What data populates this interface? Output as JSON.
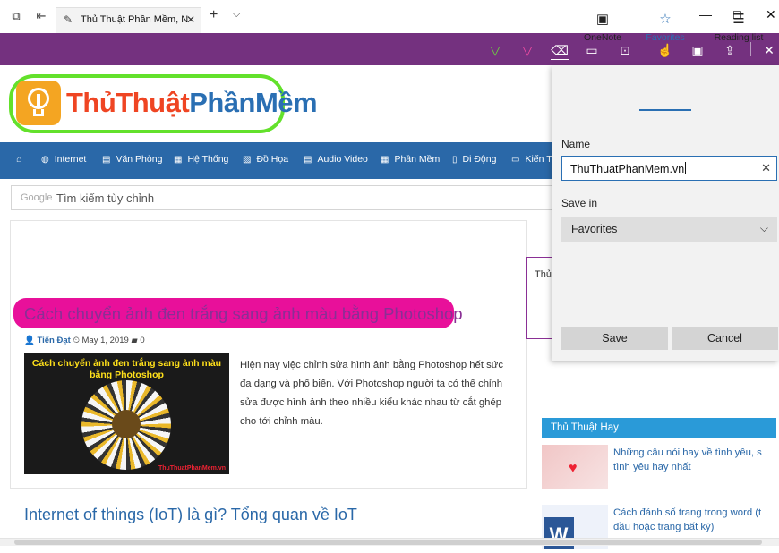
{
  "browser": {
    "tab_title": "Thủ Thuật Phần Mềm, N",
    "new_tab": "+",
    "close_glyph": "✕"
  },
  "site": {
    "logo_part1": "ThủThuật",
    "logo_part2": "PhầnMềm",
    "nav": [
      "Internet",
      "Văn Phòng",
      "Hệ Thống",
      "Đồ Họa",
      "Audio Video",
      "Phần Mềm",
      "Di Động",
      "Kiến T"
    ],
    "search_brand": "Google",
    "search_placeholder": "Tìm kiếm tùy chỉnh"
  },
  "article": {
    "title": "Cách chuyển ảnh đen trắng sang ảnh màu bằng Photoshop",
    "author": "Tiến Đạt",
    "date": "May 1, 2019",
    "comments": "0",
    "thumb_caption": "Cách chuyển ảnh đen trắng sang ảnh màu bằng Photoshop",
    "thumb_watermark": "ThuThuatPhanMem.vn",
    "excerpt": "Hiện nay việc chỉnh sửa hình ảnh bằng Photoshop hết sức đa dạng và phổ biến. Với Photoshop người ta có thể chỉnh sửa được hình ảnh theo nhiều kiểu khác nhau từ cắt ghép cho tới chỉnh màu."
  },
  "article2": {
    "title": "Internet of things (IoT) là gì? Tổng quan về IoT"
  },
  "sidebar": {
    "stub_text": "Thủ",
    "header": "Thủ Thuật Hay",
    "items": [
      {
        "title": "Những câu nói hay về tình yêu, s tình yêu hay nhất"
      },
      {
        "title": "Cách đánh số trang trong word (t đầu hoặc trang bất kỳ)"
      }
    ]
  },
  "favorites_pane": {
    "tabs": [
      {
        "label": "OneNote",
        "icon": "onenote-icon"
      },
      {
        "label": "Favorites",
        "icon": "star-icon"
      },
      {
        "label": "Reading list",
        "icon": "reading-list-icon"
      }
    ],
    "name_label": "Name",
    "name_value": "ThuThuatPhanMem.vn",
    "save_in_label": "Save in",
    "save_in_value": "Favorites",
    "save_button": "Save",
    "cancel_button": "Cancel"
  },
  "colors": {
    "ink_toolbar": "#74317f",
    "nav_bar": "#2a68a8",
    "highlight_pink": "#e8109a",
    "circle_green": "#63e12b",
    "accent_blue": "#2a6fb3"
  }
}
